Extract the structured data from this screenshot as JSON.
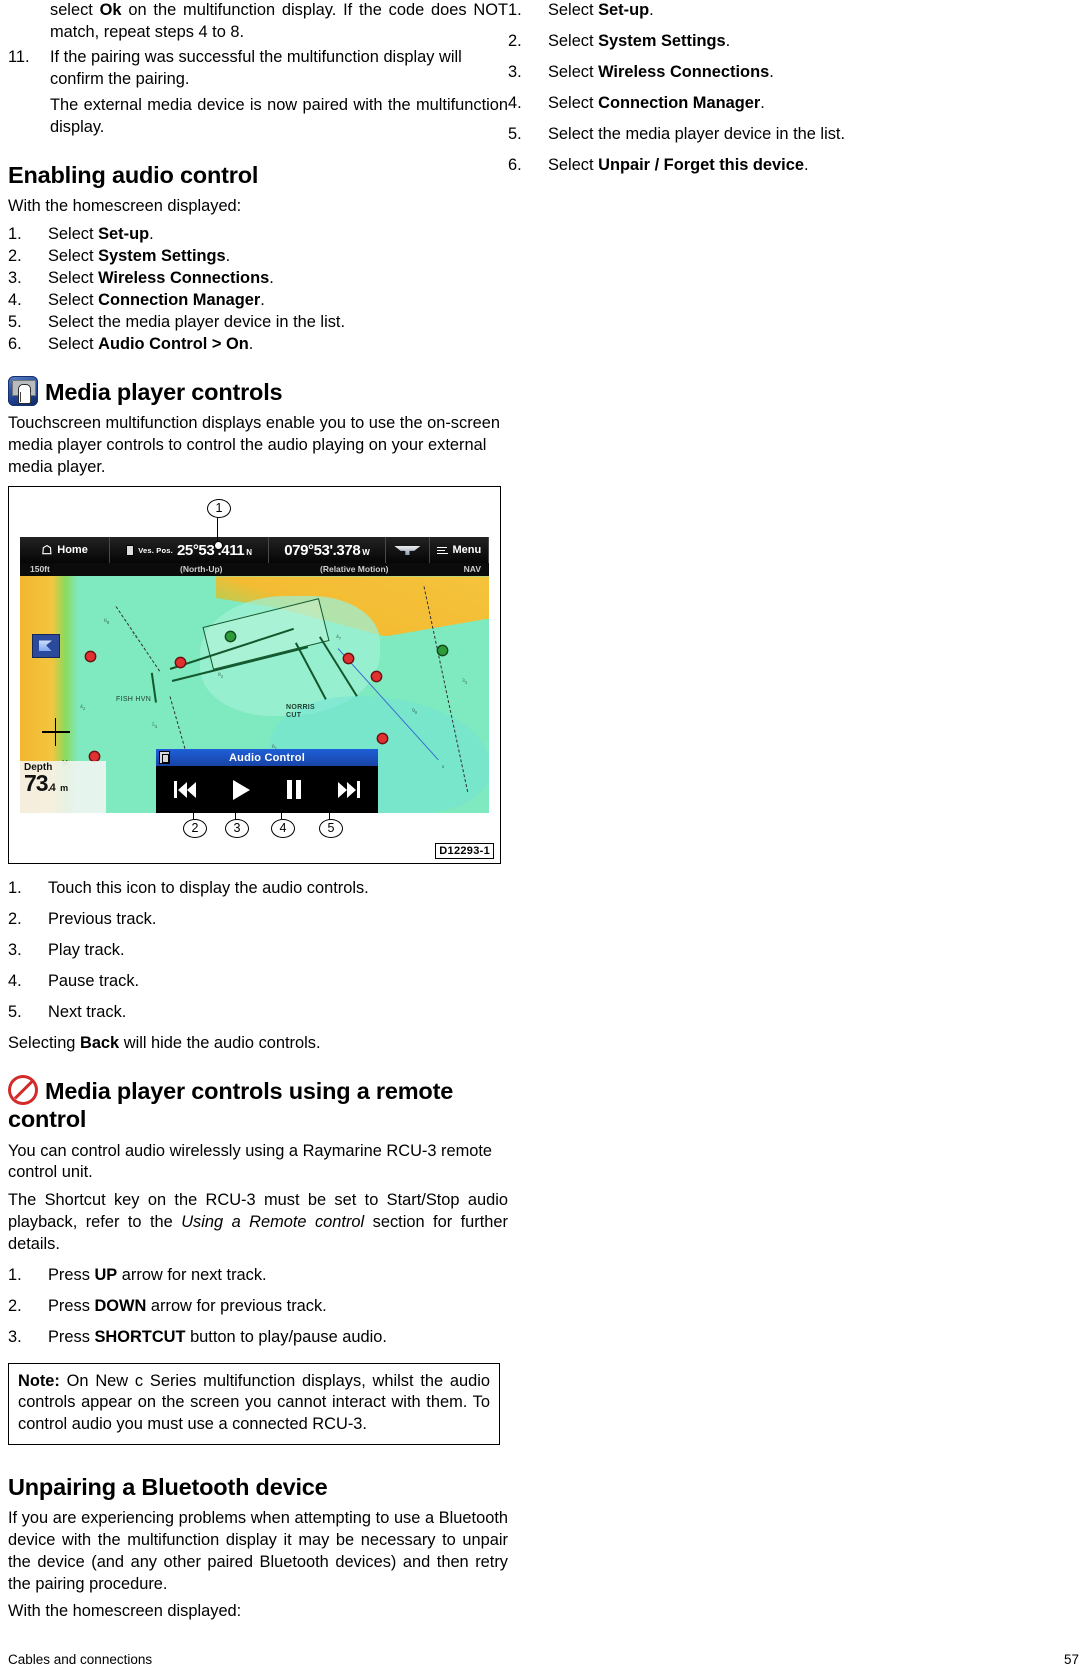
{
  "left_column": {
    "continued_list": [
      {
        "num": "",
        "text_pre": "select ",
        "bold": "Ok",
        "text_post": " on the multifunction display. If the code does NOT match, repeat steps 4 to 8."
      },
      {
        "num": "11.",
        "text_pre": "",
        "bold": "",
        "text_post": "If the pairing was successful the multifunction display will confirm the pairing."
      }
    ],
    "continued_note": "The external media device is now paired with the multifunction display.",
    "section_enabling": {
      "heading": "Enabling audio control",
      "intro": "With the homescreen displayed:",
      "steps": [
        {
          "num": "1.",
          "pre": "Select ",
          "bold": "Set-up",
          "post": "."
        },
        {
          "num": "2.",
          "pre": "Select ",
          "bold": "System Settings",
          "post": "."
        },
        {
          "num": "3.",
          "pre": "Select ",
          "bold": "Wireless Connections",
          "post": "."
        },
        {
          "num": "4.",
          "pre": "Select ",
          "bold": "Connection Manager",
          "post": "."
        },
        {
          "num": "5.",
          "pre": "Select the media player device in the list.",
          "bold": "",
          "post": ""
        },
        {
          "num": "6.",
          "pre": "Select ",
          "bold": "Audio Control > On",
          "post": "."
        }
      ]
    },
    "section_media_controls": {
      "icon": "touchscreen-icon",
      "heading": "Media player controls",
      "intro": "Touchscreen multifunction displays enable you to use the on-screen media player controls to control the audio playing on your external media player.",
      "figure": {
        "id": "D12293-1",
        "callouts": [
          "1",
          "2",
          "3",
          "4",
          "5"
        ],
        "mfd": {
          "topbar": {
            "home_label": "Home",
            "pos_label": "Ves. Pos.",
            "latitude": "25°53'.411",
            "latitude_suffix": "N",
            "longitude": "079°53'.378",
            "longitude_suffix": "W",
            "menu_label": "Menu"
          },
          "subbar": {
            "scale": "150ft",
            "orientation": "(North-Up)",
            "motion": "(Relative Motion)",
            "mode": "NAV"
          },
          "chart_labels": [
            "NORRIS CUT",
            "FISH HVN",
            "M"
          ],
          "depth": {
            "label": "Depth",
            "value": "73",
            "decimal": ".4",
            "unit": "m"
          },
          "audio_panel": {
            "title": "Audio Control",
            "buttons": [
              "previous-track",
              "play-track",
              "pause-track",
              "next-track"
            ]
          }
        }
      },
      "legend": [
        {
          "num": "1.",
          "text": "Touch this icon to display the audio controls."
        },
        {
          "num": "2.",
          "text": "Previous track."
        },
        {
          "num": "3.",
          "text": "Play track."
        },
        {
          "num": "4.",
          "text": "Pause track."
        },
        {
          "num": "5.",
          "text": "Next track."
        }
      ],
      "closing_pre": "Selecting ",
      "closing_bold": "Back",
      "closing_post": " will hide the audio controls."
    },
    "section_remote": {
      "icon": "no-entry-icon",
      "heading": "Media player controls using a remote control",
      "para1": "You can control audio wirelessly using a Raymarine RCU-3 remote control unit.",
      "para2_pre": "The Shortcut key on the RCU-3 must be set to Start/Stop audio playback, refer to the ",
      "para2_italic": "Using a Remote control",
      "para2_post": " section for further details.",
      "steps": [
        {
          "num": "1.",
          "pre": "Press ",
          "bold": "UP",
          "post": " arrow for next track."
        },
        {
          "num": "2.",
          "pre": "Press ",
          "bold": "DOWN",
          "post": " arrow for previous track."
        },
        {
          "num": "3.",
          "pre": "Press ",
          "bold": "SHORTCUT",
          "post": " button to play/pause audio."
        }
      ],
      "note": {
        "label": "Note:",
        "text": " On New c Series multifunction displays, whilst the audio controls appear on the screen you cannot interact with them. To control audio you must use a connected RCU-3."
      }
    },
    "section_unpairing": {
      "heading": "Unpairing a Bluetooth device",
      "para1": "If you are experiencing problems when attempting to use a Bluetooth device with the multifunction display it may be necessary to unpair the device (and any other paired Bluetooth devices) and then retry the pairing procedure.",
      "para2": "With the homescreen displayed:"
    }
  },
  "right_column": {
    "steps": [
      {
        "num": "1.",
        "pre": "Select ",
        "bold": "Set-up",
        "post": "."
      },
      {
        "num": "2.",
        "pre": "Select ",
        "bold": "System Settings",
        "post": "."
      },
      {
        "num": "3.",
        "pre": "Select ",
        "bold": "Wireless Connections",
        "post": "."
      },
      {
        "num": "4.",
        "pre": "Select ",
        "bold": "Connection Manager",
        "post": "."
      },
      {
        "num": "5.",
        "pre": "Select the media player device in the list.",
        "bold": "",
        "post": ""
      },
      {
        "num": "6.",
        "pre": "Select ",
        "bold": "Unpair / Forget this device",
        "post": "."
      }
    ]
  },
  "footer": {
    "chapter": "Cables and connections",
    "page": "57"
  }
}
